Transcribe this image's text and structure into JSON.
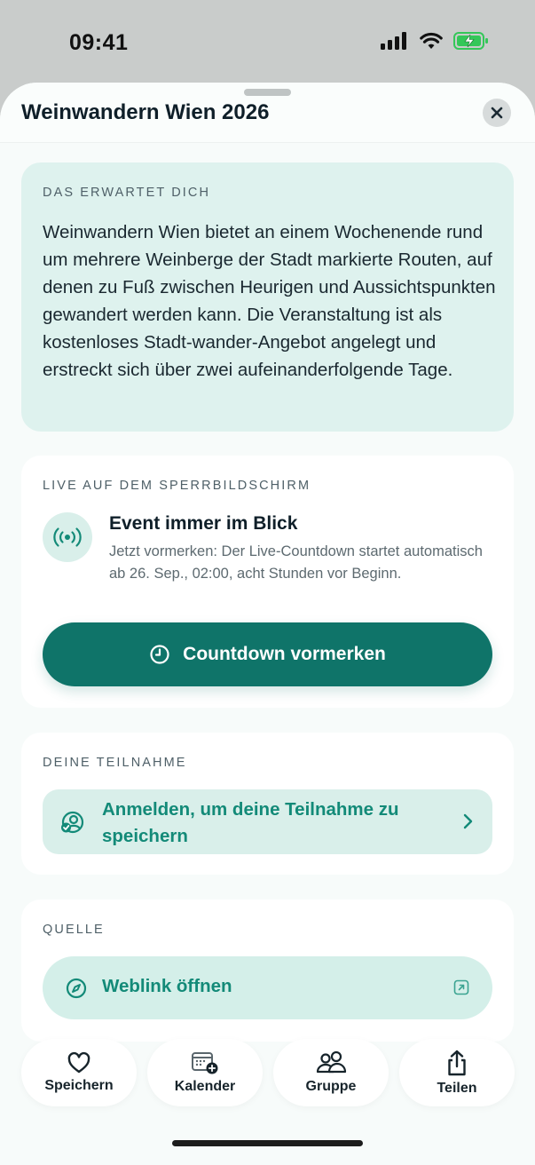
{
  "status_bar": {
    "time": "09:41",
    "icons": [
      "cellular-signal-icon",
      "wifi-icon",
      "battery-charging-icon"
    ],
    "battery_color": "#34c759"
  },
  "sheet": {
    "title": "Weinwandern Wien 2026",
    "close_icon": "close-icon"
  },
  "about": {
    "label": "DAS ERWARTET DICH",
    "text": "Weinwandern Wien bietet an einem Wochenende rund um mehrere Weinberge der Stadt markierte Routen, auf denen zu Fuß zwischen Heurigen und Aussichtspunkten gewandert werden kann. Die Veranstaltung ist als kostenloses Stadt-wander-Angebot angelegt und erstreckt sich über zwei aufeinanderfolgende Tage."
  },
  "live": {
    "label": "LIVE AUF DEM SPERRBILDSCHIRM",
    "icon": "broadcast-icon",
    "title": "Event immer im Blick",
    "subtitle": "Jetzt vormerken: Der Live-Countdown startet automatisch ab 26. Sep., 02:00, acht Stunden vor Beginn.",
    "button_label": "Countdown vormerken",
    "button_icon": "clock-icon"
  },
  "participation": {
    "label": "DEINE TEILNAHME",
    "button_label": "Anmelden, um deine Teilnahme zu speichern",
    "button_icon": "user-check-icon"
  },
  "source": {
    "label": "QUELLE",
    "button_label": "Weblink öffnen",
    "button_icon": "compass-icon",
    "trailing_icon": "external-link-icon"
  },
  "actions": [
    {
      "label": "Speichern",
      "icon": "heart-icon"
    },
    {
      "label": "Kalender",
      "icon": "calendar-add-icon"
    },
    {
      "label": "Gruppe",
      "icon": "group-icon"
    },
    {
      "label": "Teilen",
      "icon": "share-icon"
    }
  ],
  "colors": {
    "accent": "#0f7469",
    "accent_text": "#138a78",
    "mint_bg": "#def2ee"
  }
}
